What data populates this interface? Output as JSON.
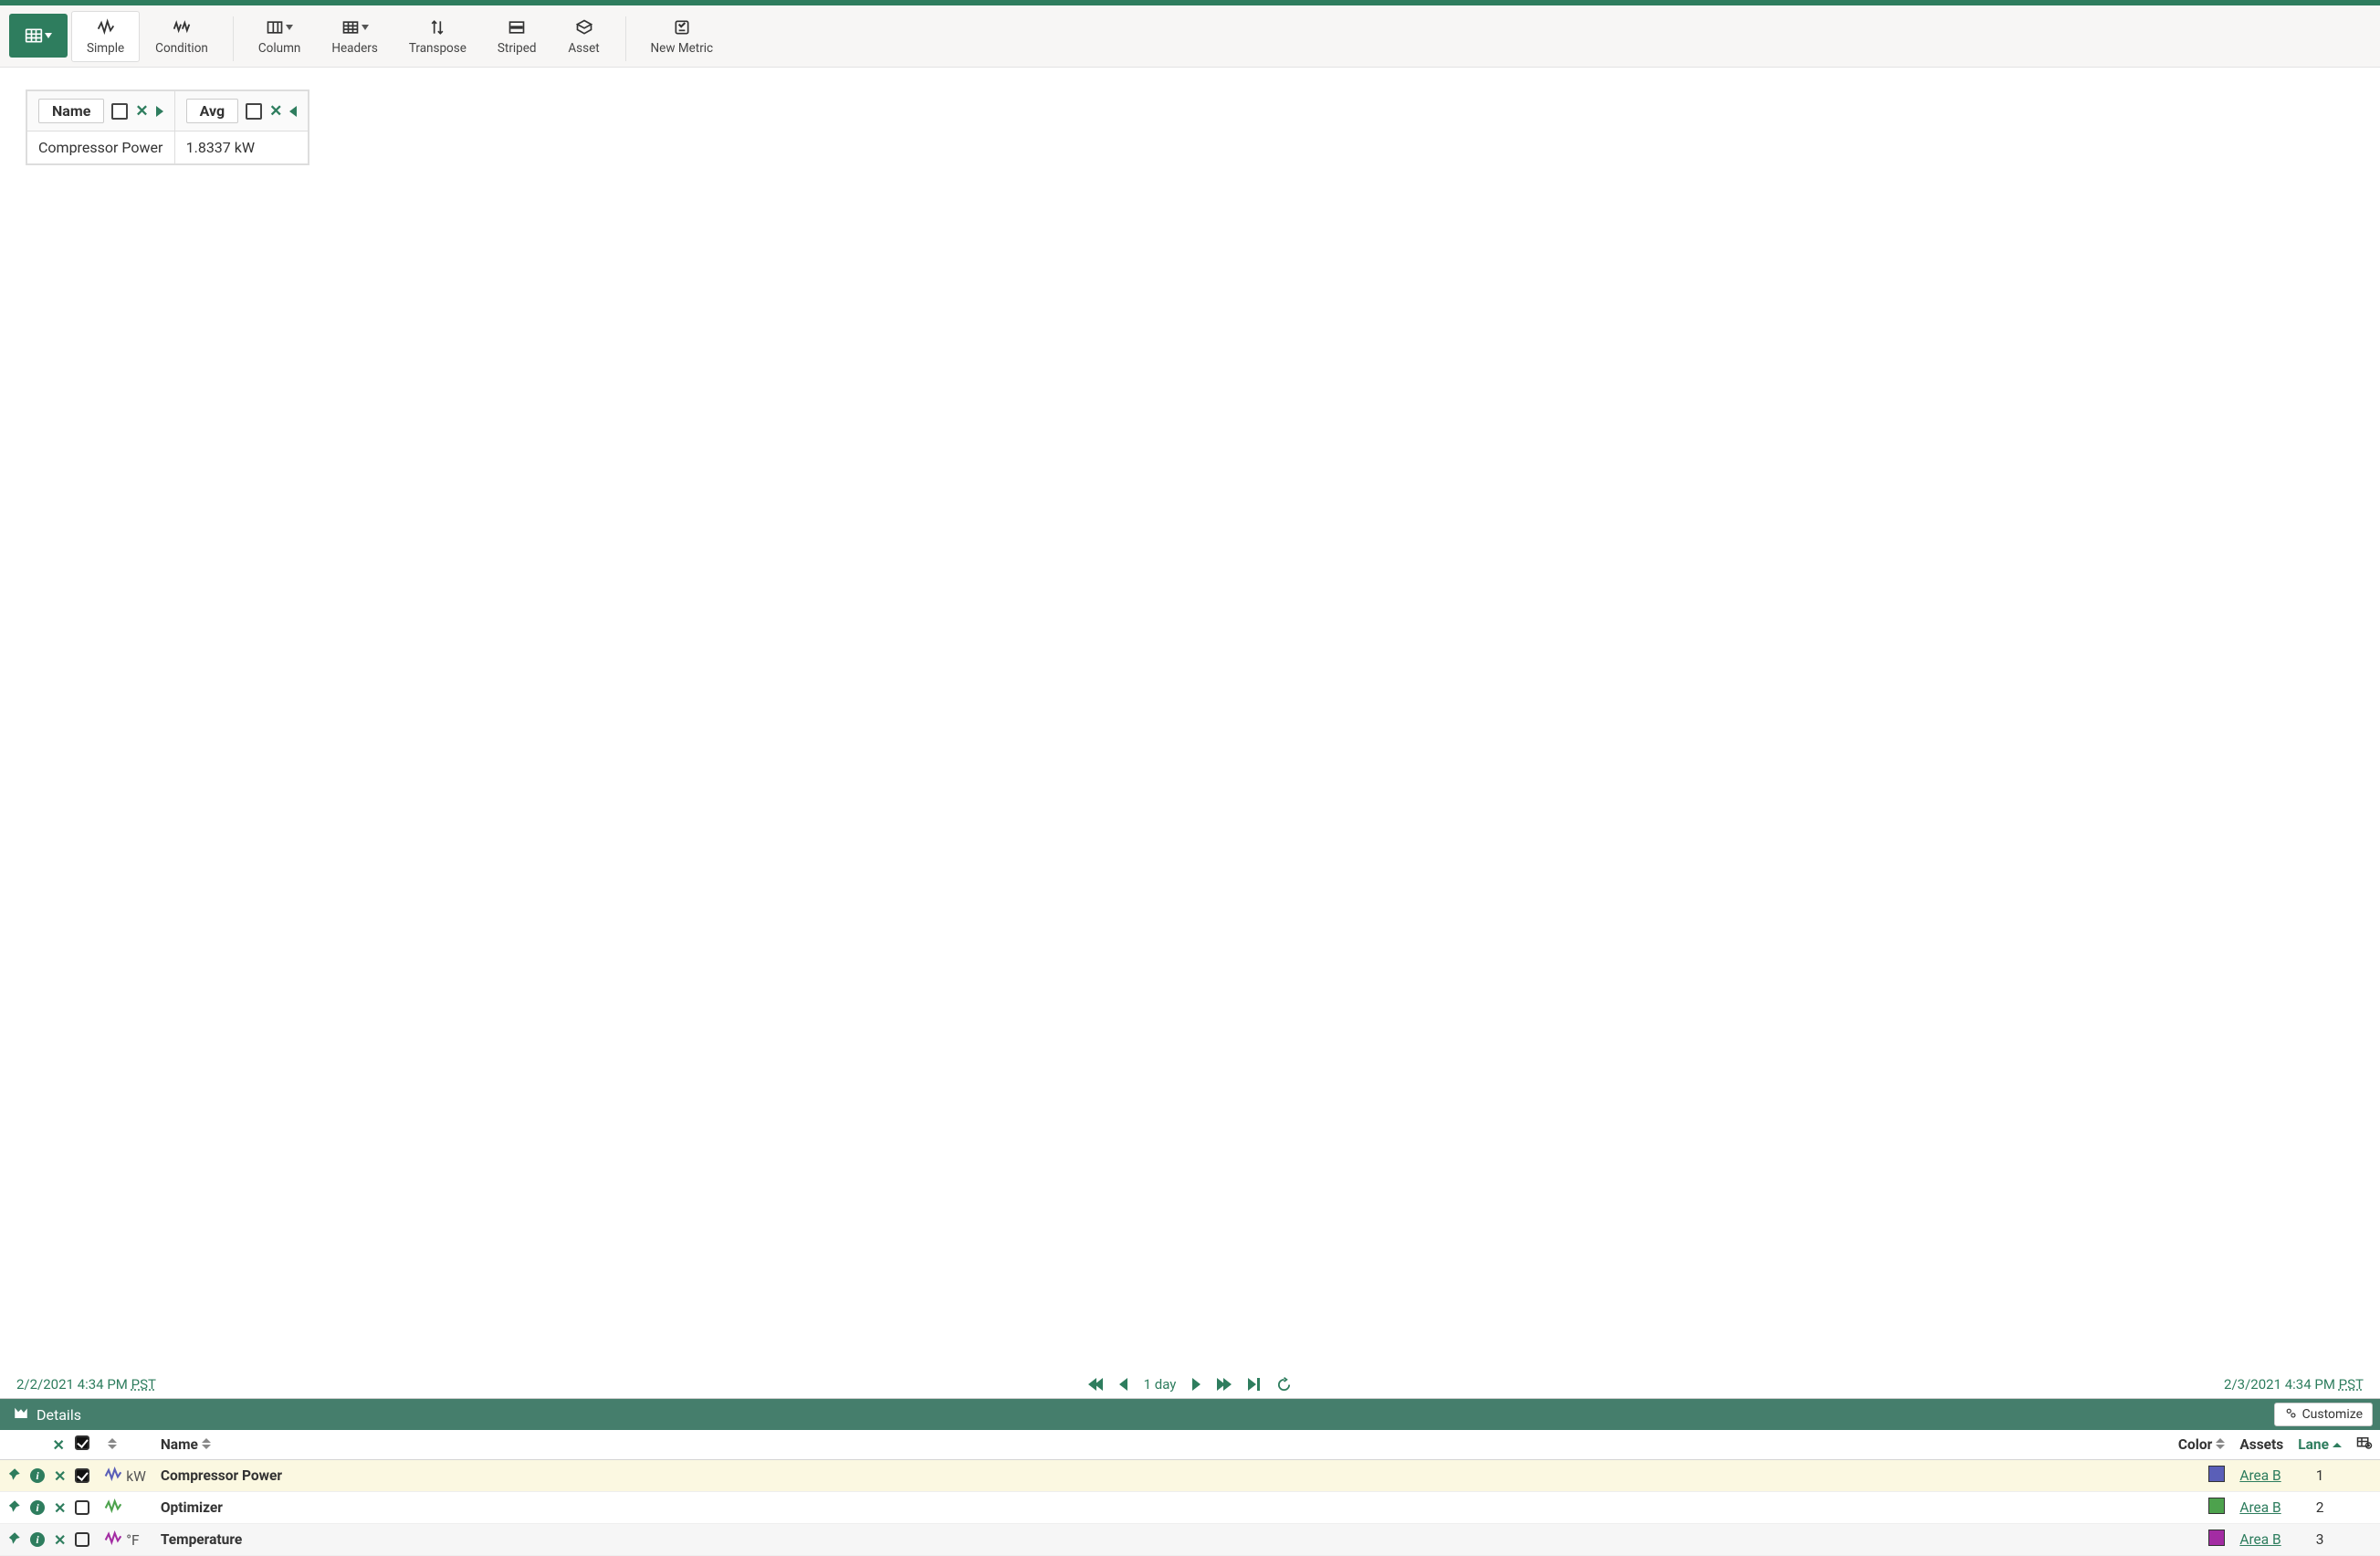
{
  "toolbar": {
    "simple": "Simple",
    "condition": "Condition",
    "column": "Column",
    "headers": "Headers",
    "transpose": "Transpose",
    "striped": "Striped",
    "asset": "Asset",
    "new_metric": "New Metric"
  },
  "grid": {
    "col1_label": "Name",
    "col2_label": "Avg",
    "row1_name": "Compressor Power",
    "row1_value": "1.8337 kW"
  },
  "time": {
    "start": "2/2/2021 4:34 PM ",
    "start_tz": "PST",
    "range": "1 day",
    "end": "2/3/2021 4:34 PM ",
    "end_tz": "PST"
  },
  "details": {
    "title": "Details",
    "customize": "Customize",
    "headers": {
      "name": "Name",
      "color": "Color",
      "assets": "Assets",
      "lane": "Lane"
    },
    "rows": [
      {
        "unit": "kW",
        "name": "Compressor Power",
        "color": "#5a5fb8",
        "asset": "Area B",
        "lane": "1",
        "checked": true,
        "selected": true,
        "sigColor": "#5a5fb8"
      },
      {
        "unit": "",
        "name": "Optimizer",
        "color": "#4da24d",
        "asset": "Area B",
        "lane": "2",
        "checked": false,
        "selected": false,
        "sigColor": "#4da24d"
      },
      {
        "unit": "°F",
        "name": "Temperature",
        "color": "#a32ca3",
        "asset": "Area B",
        "lane": "3",
        "checked": false,
        "selected": false,
        "sigColor": "#a32ca3"
      }
    ]
  }
}
